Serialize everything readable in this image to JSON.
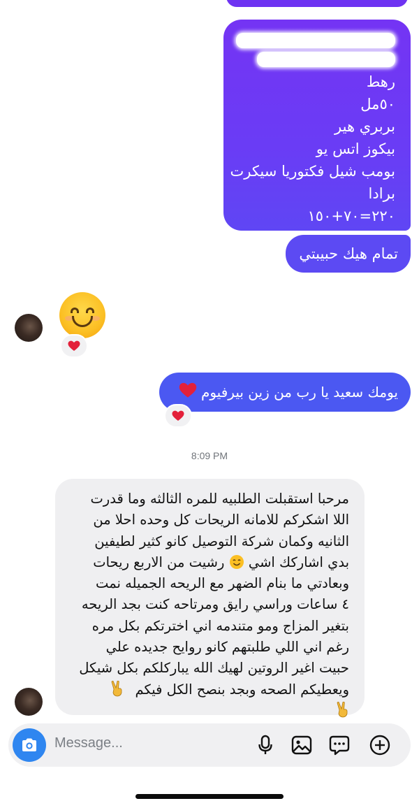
{
  "messages": {
    "outgoing_list": {
      "lines": [
        "رهط",
        "٥٠مل",
        "بربري هير",
        "بيكوز اتس يو",
        "بومب شيل فكتوريا سيكرت",
        "برادا",
        "٢٢٠=٧٠+١٥٠"
      ]
    },
    "outgoing_ok": {
      "text": "تمام هيك حبيبتي"
    },
    "incoming_emoji": {
      "emoji": "smiling-face-with-smiling-eyes",
      "reaction": "heart"
    },
    "outgoing_greeting": {
      "text": "يومك سعيد يا رب من زين بيرفيوم",
      "emoji": "heart",
      "reaction": "heart"
    },
    "timestamp": "8:09 PM",
    "incoming_long": {
      "lines": [
        "مرحبا استقبلت الطلبيه للمره الثالثه وما قدرت",
        "اللا اشكركم للامانه الريحات كل وحده احلا من",
        "الثانيه وكمان شركة التوصيل كانو كثير لطيفين",
        "بدي اشاركك اشي",
        "رشيت من الاربع ريحات",
        "وبعادتي ما بنام الضهر مع الريحه الجميله نمت",
        "٤ ساعات  وراسي رايق ومرتاحه كنت بجد الريحه",
        "بتغير المزاج ومو متندمه اني اخترتكم بكل مره",
        "رغم اني اللي طلبتهم كانو روايح جديده علي",
        "حبيت اغير الروتين لهيك الله يباركلكم بكل شيكل",
        "ويعطيكم الصحه وبجد بنصح الكل فيكم"
      ],
      "trailing_emoji": "victory-hand"
    }
  },
  "composer": {
    "placeholder": "Message..."
  },
  "colors": {
    "outgoing_top": "#7434f4",
    "outgoing_bottom": "#4b58f2",
    "incoming": "#efeff1",
    "camera": "#2f86f0"
  }
}
